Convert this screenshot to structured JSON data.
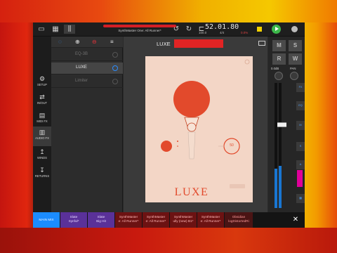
{
  "transport": {
    "preset_title": "SynthMaster One: All Runner*",
    "time": "52.01.80",
    "tempo": "100.0",
    "signature": "4/4",
    "cpu": "0.0%"
  },
  "nav": {
    "items": [
      {
        "label": "SETUP",
        "icon": "gear-icon"
      },
      {
        "label": "IN/OUT",
        "icon": "io-icon"
      },
      {
        "label": "MIDI FX",
        "icon": "midi-fx-icon"
      },
      {
        "label": "AUDIO FX",
        "icon": "audio-fx-icon"
      },
      {
        "label": "WINDS",
        "icon": "winds-icon"
      },
      {
        "label": "RETURNS",
        "icon": "returns-icon"
      }
    ]
  },
  "fx_list": {
    "items": [
      {
        "name": "EQ-3B",
        "active": false
      },
      {
        "name": "LUXE",
        "active": true
      },
      {
        "name": "Limiter",
        "active": false
      }
    ]
  },
  "plugin": {
    "name": "LUXE",
    "preset_label": "",
    "wordmark": "LUXE",
    "knob_value": "50"
  },
  "mixer": {
    "m_label": "M",
    "s_label": "S",
    "r_label": "R",
    "w_label": "W",
    "volume": "0.0dB",
    "pan": "PAN",
    "accent": "#1976d2"
  },
  "tabs": [
    {
      "line1": "MAIN MIX",
      "line2": ""
    },
    {
      "line1": "Slate",
      "line2": "Synful*"
    },
    {
      "line1": "Slate",
      "line2": "Big Hit"
    },
    {
      "line1": "SynthMaster",
      "line2": "e: All Runner*"
    },
    {
      "line1": "SynthMaster",
      "line2": "e: All Runner*"
    },
    {
      "line1": "SynthMaster",
      "line2": "ully (new) B1*"
    },
    {
      "line1": "SynthMaster",
      "line2": "e: All Runner*"
    },
    {
      "line1": "Obsidian",
      "line2": "logDistortedRi"
    }
  ],
  "close_label": "✕"
}
